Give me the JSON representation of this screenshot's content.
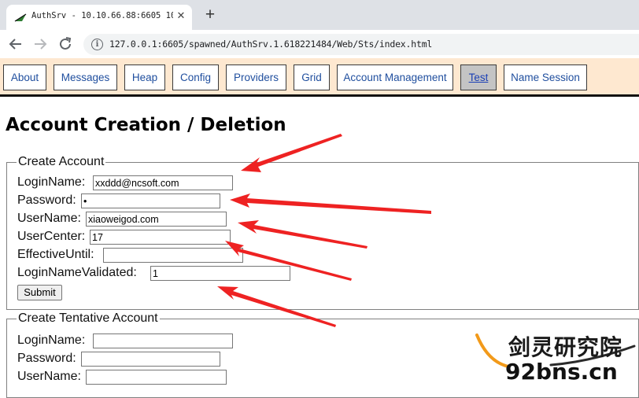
{
  "browser": {
    "tab_title": "AuthSrv - 10.10.66.88:6605 10",
    "tab_close_glyph": "✕",
    "new_tab_glyph": "+",
    "url": "127.0.0.1:6605/spawned/AuthSrv.1.618221484/Web/Sts/index.html",
    "icons": [
      "back-arrow-icon",
      "forward-arrow-icon",
      "reload-icon",
      "info-icon"
    ]
  },
  "nav": {
    "items": [
      "About",
      "Messages",
      "Heap",
      "Config",
      "Providers",
      "Grid",
      "Account Management",
      "Test",
      "Name Session"
    ],
    "active": "Test"
  },
  "page": {
    "title": "Account Creation / Deletion"
  },
  "create_account": {
    "legend": "Create Account",
    "fields": [
      {
        "label": "LoginName:",
        "value": "xxddd@ncsoft.com"
      },
      {
        "label": "Password:",
        "value": "•"
      },
      {
        "label": "UserName:",
        "value": "xiaoweigod.com"
      },
      {
        "label": "UserCenter:",
        "value": "17"
      },
      {
        "label": "EffectiveUntil:",
        "value": ""
      },
      {
        "label": "LoginNameValidated:",
        "value": "1"
      }
    ],
    "submit_label": "Submit"
  },
  "create_tentative": {
    "legend": "Create Tentative Account",
    "fields": [
      {
        "label": "LoginName:",
        "value": ""
      },
      {
        "label": "Password:",
        "value": ""
      },
      {
        "label": "UserName:",
        "value": ""
      }
    ]
  },
  "watermark": {
    "line1": "剑灵研究院",
    "line2": "92bns.cn"
  },
  "colors": {
    "nav_bg": "#fee8d0",
    "annotation_arrow": "#ee2222",
    "watermark_orange": "#f29a1a"
  }
}
